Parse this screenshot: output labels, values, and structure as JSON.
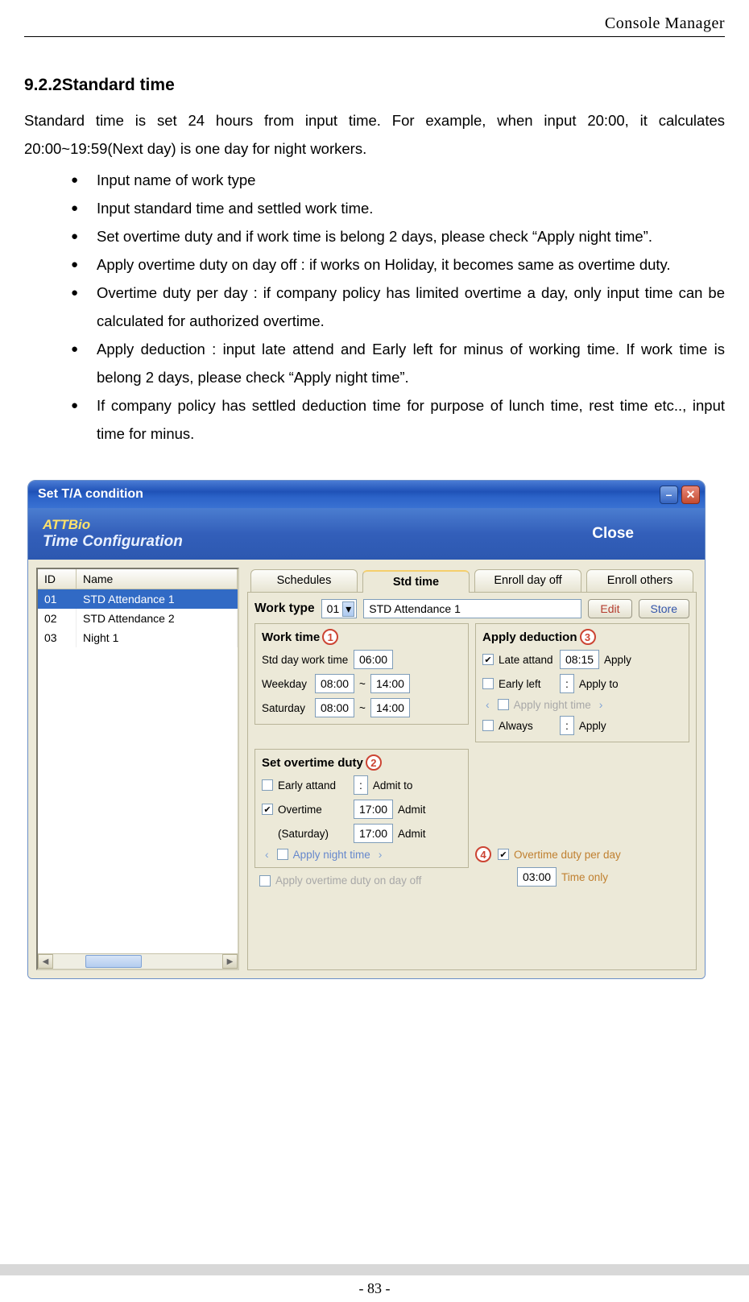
{
  "header": {
    "title": "Console Manager"
  },
  "section": {
    "number": "9.2.2",
    "title": "Standard time",
    "intro": "Standard time is set 24 hours from input time. For example, when input 20:00, it calculates 20:00~19:59(Next day) is one day for night workers.",
    "bullets": [
      "Input name of work type",
      "Input standard time and settled work time.",
      "Set overtime duty and if work time is belong 2 days, please check “Apply night time”.",
      "Apply overtime duty on day off : if works on Holiday, it becomes same as overtime duty.",
      "Overtime duty per day : if company policy has limited overtime a day, only input time can be calculated for authorized overtime.",
      "Apply deduction : input late attend and Early left for minus of working time. If work time is belong 2 days, please check “Apply night time”.",
      "If company policy has settled deduction time for purpose of lunch time, rest time etc.., input time for minus."
    ]
  },
  "dialog": {
    "title": "Set T/A condition",
    "brand": {
      "line1": "ATTBio",
      "line2": "Time Configuration"
    },
    "close_label": "Close",
    "list": {
      "columns": {
        "id": "ID",
        "name": "Name"
      },
      "rows": [
        {
          "id": "01",
          "name": "STD Attendance 1",
          "selected": true
        },
        {
          "id": "02",
          "name": "STD Attendance 2",
          "selected": false
        },
        {
          "id": "03",
          "name": "Night 1",
          "selected": false
        }
      ]
    },
    "tabs": [
      {
        "label": "Schedules",
        "active": false
      },
      {
        "label": "Std time",
        "active": true
      },
      {
        "label": "Enroll day off",
        "active": false
      },
      {
        "label": "Enroll others",
        "active": false
      }
    ],
    "worktype": {
      "label": "Work type",
      "id": "01",
      "name": "STD Attendance 1",
      "edit": "Edit",
      "store": "Store"
    },
    "worktime": {
      "title": "Work time",
      "marker": "1",
      "std_label": "Std day work time",
      "std_value": "06:00",
      "weekday_label": "Weekday",
      "weekday_from": "08:00",
      "weekday_to": "14:00",
      "saturday_label": "Saturday",
      "saturday_from": "08:00",
      "saturday_to": "14:00",
      "tilde": "~"
    },
    "deduction": {
      "title": "Apply deduction",
      "marker": "3",
      "late_label": "Late attand",
      "late_checked": true,
      "late_value": "08:15",
      "late_suffix": "Apply",
      "early_label": "Early left",
      "early_checked": false,
      "early_value": ":",
      "early_suffix": "Apply to",
      "night_label": "Apply night time",
      "always_label": "Always",
      "always_checked": false,
      "always_value": ":",
      "always_suffix": "Apply"
    },
    "overtime": {
      "title": "Set overtime duty",
      "marker": "2",
      "early_label": "Early attand",
      "early_checked": false,
      "early_value": ":",
      "early_suffix": "Admit to",
      "ot_label": "Overtime",
      "ot_checked": true,
      "ot_value": "17:00",
      "ot_suffix": "Admit",
      "sat_label": "(Saturday)",
      "sat_value": "17:00",
      "sat_suffix": "Admit",
      "night_label": "Apply night time",
      "dayoff_label": "Apply overtime duty on day off",
      "dayoff_checked": false
    },
    "otday": {
      "marker": "4",
      "label": "Overtime duty per day",
      "checked": true,
      "value": "03:00",
      "suffix": "Time only"
    }
  },
  "footer": {
    "page": "- 83 -"
  }
}
